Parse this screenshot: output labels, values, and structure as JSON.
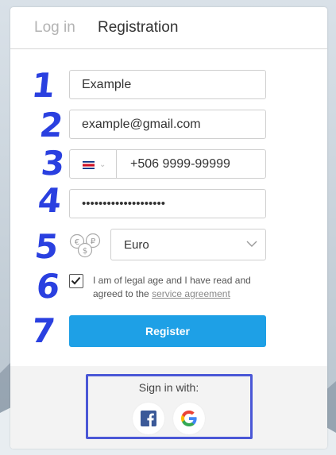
{
  "tabs": {
    "login": "Log in",
    "registration": "Registration"
  },
  "form": {
    "name_value": "Example",
    "email_value": "example@gmail.com",
    "phone_value": "+506 9999-99999",
    "password_value": "••••••••••••••••••••",
    "currency_value": "Euro",
    "agree_text_prefix": "I am of legal age and I have read and agreed to the",
    "agree_link": "service agreement",
    "register_label": "Register"
  },
  "footer": {
    "sign_in_with": "Sign in with:"
  },
  "annotations": [
    "1",
    "2",
    "3",
    "4",
    "5",
    "6",
    "7"
  ],
  "colors": {
    "accent": "#1ea0e6",
    "annotation": "#2a40e0",
    "highlight": "#4a57d6"
  },
  "icons": {
    "flag": "costa-rica-flag-icon",
    "currency": "currency-coins-icon",
    "facebook": "facebook-icon",
    "google": "google-icon"
  }
}
